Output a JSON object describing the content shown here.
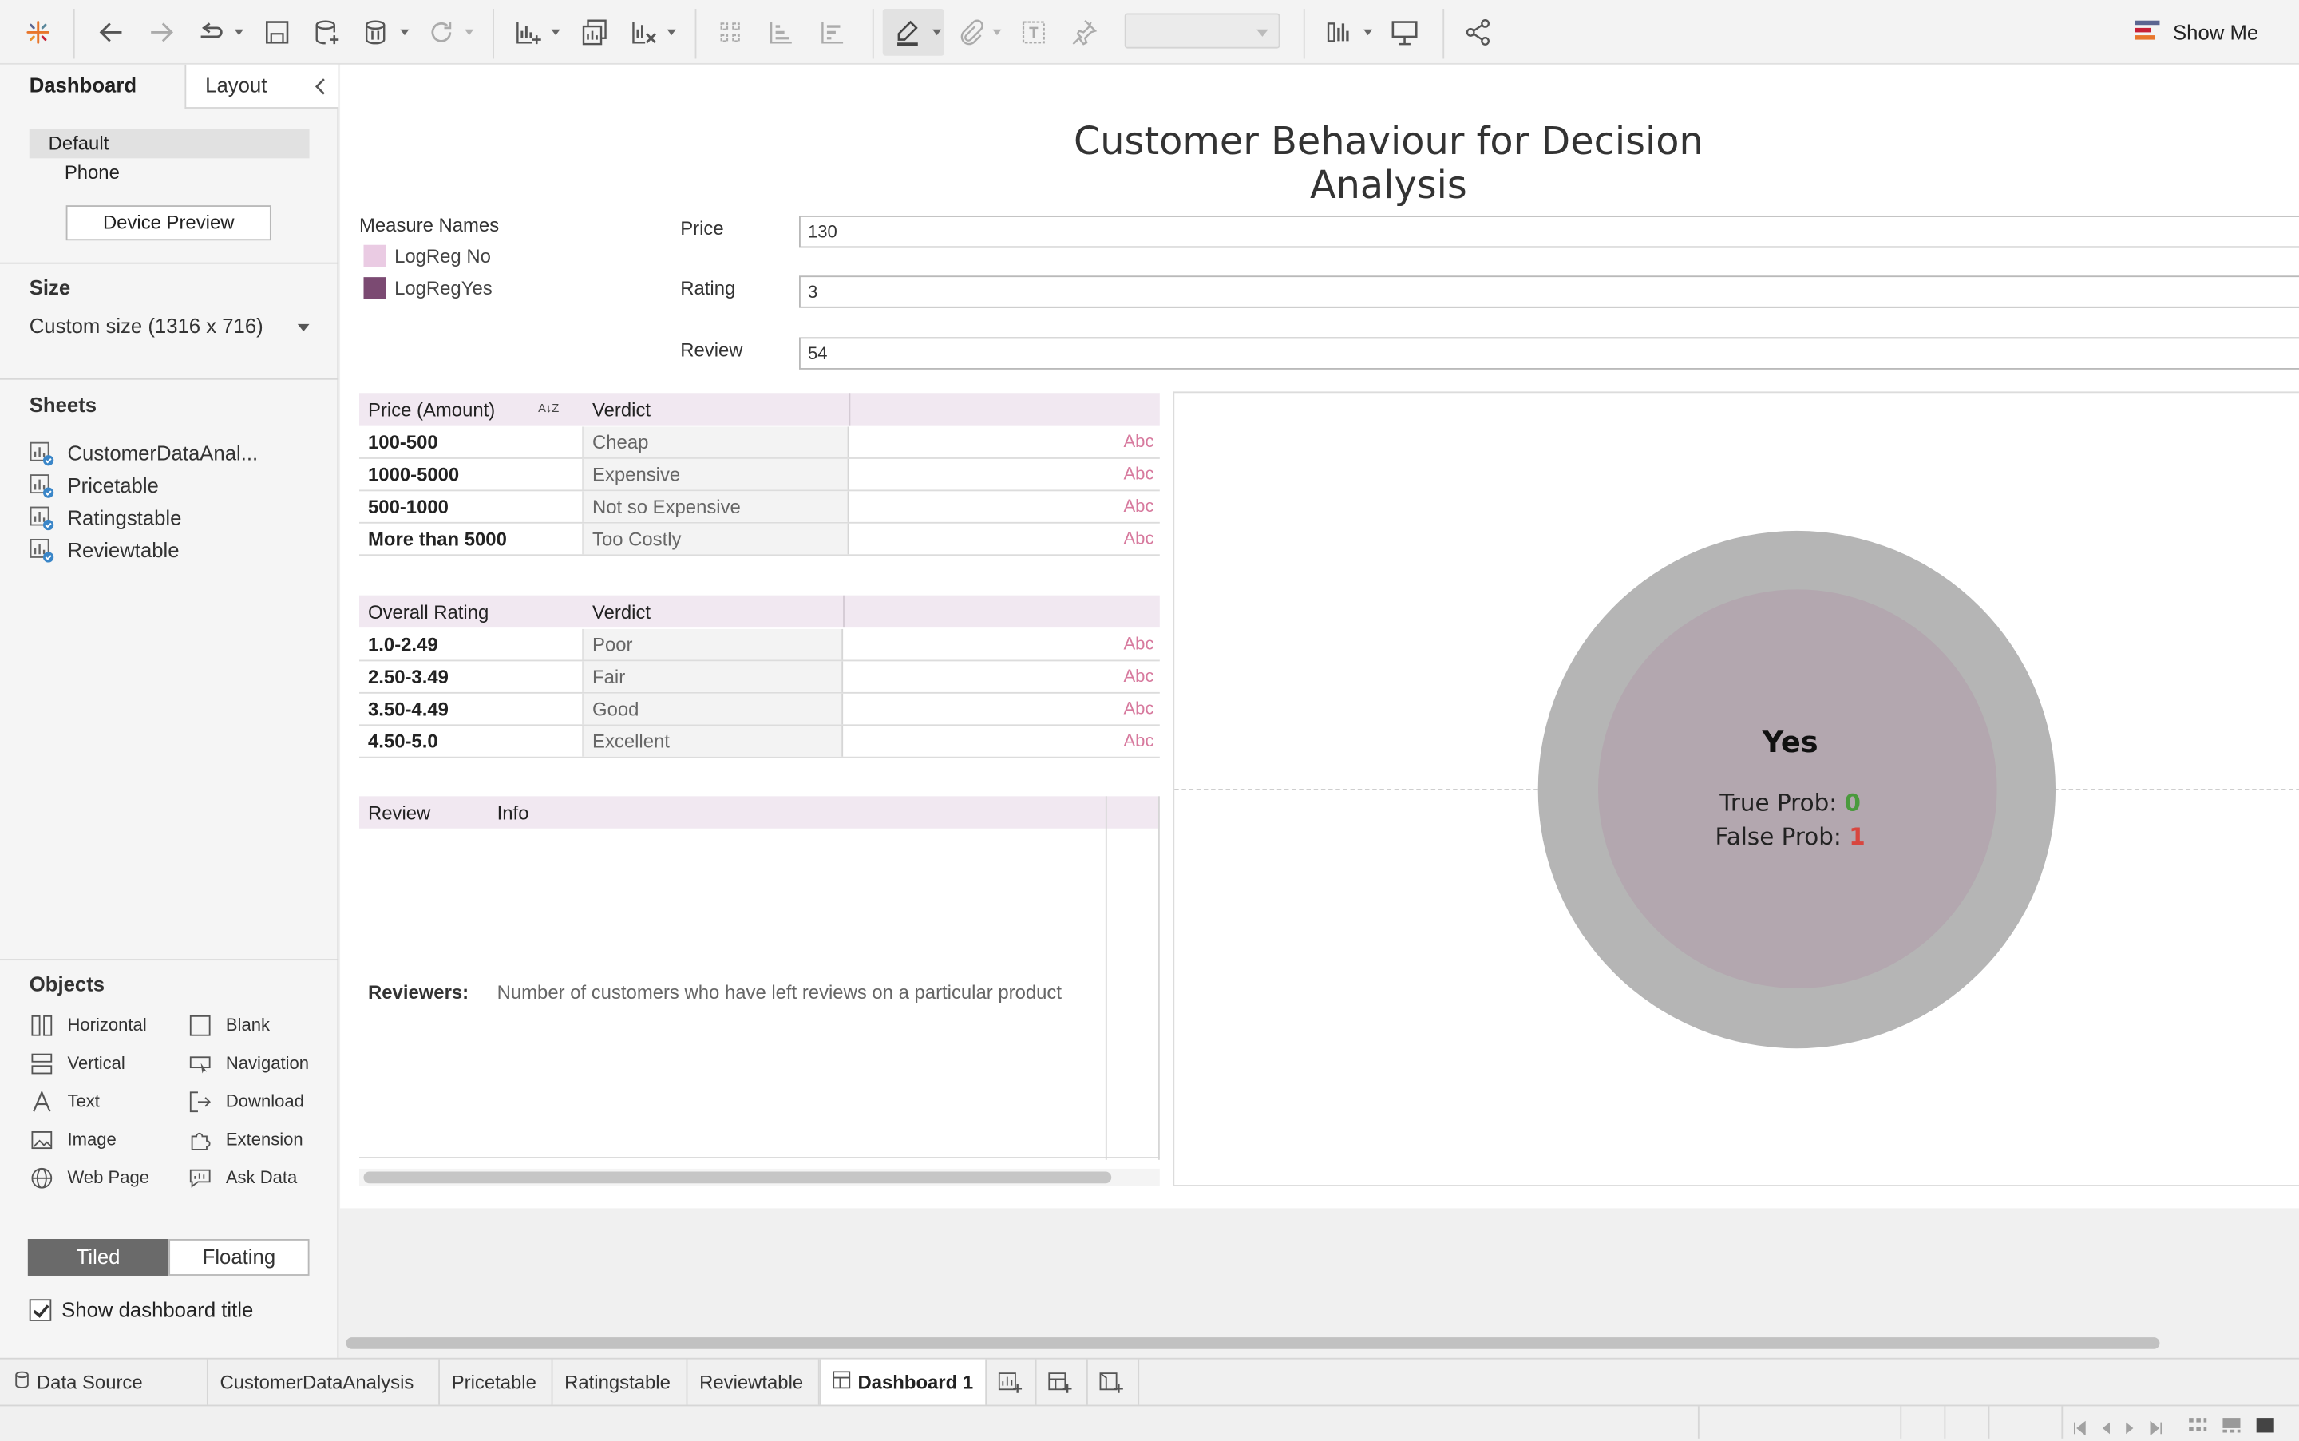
{
  "toolbar": {
    "show_me_label": "Show Me",
    "icons": [
      "tableau-logo-icon",
      "undo-icon",
      "redo-icon",
      "redo-all-icon",
      "save-icon",
      "new-data-source-icon",
      "pause-auto-updates-icon",
      "refresh-icon",
      "new-worksheet-icon",
      "duplicate-sheet-icon",
      "clear-sheet-icon",
      "swap-icon",
      "sort-ascending-icon",
      "sort-descending-icon",
      "highlight-icon",
      "annotate-icon",
      "text-icon",
      "pin-icon",
      "fit-icon",
      "presentation-icon",
      "share-icon"
    ]
  },
  "left_panel": {
    "tab_dashboard": "Dashboard",
    "tab_layout": "Layout",
    "device_default": "Default",
    "device_phone": "Phone",
    "device_preview_button": "Device Preview",
    "size_heading": "Size",
    "size_value": "Custom size (1316 x 716)",
    "sheets_heading": "Sheets",
    "sheets": [
      {
        "label": "CustomerDataAnal..."
      },
      {
        "label": "Pricetable"
      },
      {
        "label": "Ratingstable"
      },
      {
        "label": "Reviewtable"
      }
    ],
    "objects_heading": "Objects",
    "objects": [
      {
        "label": "Horizontal",
        "icon": "horizontal-icon"
      },
      {
        "label": "Blank",
        "icon": "blank-icon"
      },
      {
        "label": "Vertical",
        "icon": "vertical-icon"
      },
      {
        "label": "Navigation",
        "icon": "navigation-icon"
      },
      {
        "label": "Text",
        "icon": "text-icon"
      },
      {
        "label": "Download",
        "icon": "download-icon"
      },
      {
        "label": "Image",
        "icon": "image-icon"
      },
      {
        "label": "Extension",
        "icon": "extension-icon"
      },
      {
        "label": "Web Page",
        "icon": "web-page-icon"
      },
      {
        "label": "Ask Data",
        "icon": "ask-data-icon"
      }
    ],
    "tiled_label": "Tiled",
    "floating_label": "Floating",
    "show_title_label": "Show dashboard title",
    "show_title_checked": true
  },
  "dashboard": {
    "title": "Customer Behaviour for Decision Analysis",
    "legend": {
      "title": "Measure Names",
      "items": [
        {
          "label": "LogReg No",
          "color": "#eacbe3"
        },
        {
          "label": "LogRegYes",
          "color": "#7b4a72"
        }
      ]
    },
    "params": {
      "price_label": "Price",
      "price_value": "130",
      "rating_label": "Rating",
      "rating_value": "3",
      "review_label": "Review",
      "review_value": "54"
    },
    "price_table": {
      "col1": "Price (Amount)",
      "col2": "Verdict",
      "sort_glyph": "A↓Z",
      "rows": [
        {
          "range": "100-500",
          "verdict": "Cheap",
          "mark": "Abc"
        },
        {
          "range": "1000-5000",
          "verdict": "Expensive",
          "mark": "Abc"
        },
        {
          "range": "500-1000",
          "verdict": "Not so Expensive",
          "mark": "Abc"
        },
        {
          "range": "More than 5000",
          "verdict": "Too Costly",
          "mark": "Abc"
        }
      ]
    },
    "rating_table": {
      "col1": "Overall Rating",
      "col2": "Verdict",
      "rows": [
        {
          "range": "1.0-2.49",
          "verdict": "Poor",
          "mark": "Abc"
        },
        {
          "range": "2.50-3.49",
          "verdict": "Fair",
          "mark": "Abc"
        },
        {
          "range": "3.50-4.49",
          "verdict": "Good",
          "mark": "Abc"
        },
        {
          "range": "4.50-5.0",
          "verdict": "Excellent",
          "mark": "Abc"
        }
      ]
    },
    "review_table": {
      "col1": "Review",
      "col2": "Info",
      "row_label": "Reviewers:",
      "row_text": "Number of customers who have left reviews on a particular product"
    },
    "viz": {
      "result": "Yes",
      "true_prob_label": "True Prob:",
      "true_prob_value": "0",
      "false_prob_label": "False Prob:",
      "false_prob_value": "1",
      "outer_color": "#b5b5b5",
      "inner_color": "#b3a7af"
    }
  },
  "bottom_tabs": {
    "data_source": "Data Source",
    "tabs": [
      "CustomerDataAnalysis",
      "Pricetable",
      "Ratingstable",
      "Reviewtable"
    ],
    "active_tab": "Dashboard 1"
  }
}
